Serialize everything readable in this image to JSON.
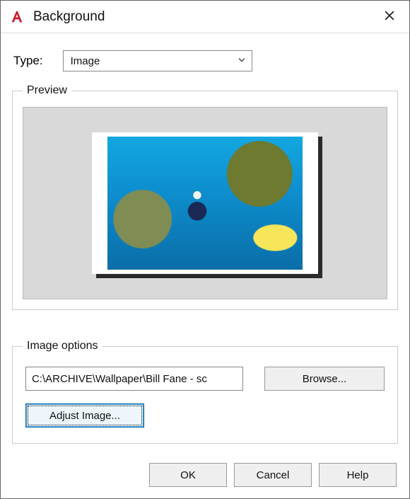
{
  "window": {
    "title": "Background",
    "app_icon": "autocad-a-icon"
  },
  "type": {
    "label": "Type:",
    "selected": "Image"
  },
  "preview": {
    "legend": "Preview"
  },
  "image_options": {
    "legend": "Image options",
    "path": "C:\\ARCHIVE\\Wallpaper\\Bill Fane - sc",
    "browse_label": "Browse...",
    "adjust_label": "Adjust Image..."
  },
  "footer": {
    "ok": "OK",
    "cancel": "Cancel",
    "help": "Help"
  }
}
